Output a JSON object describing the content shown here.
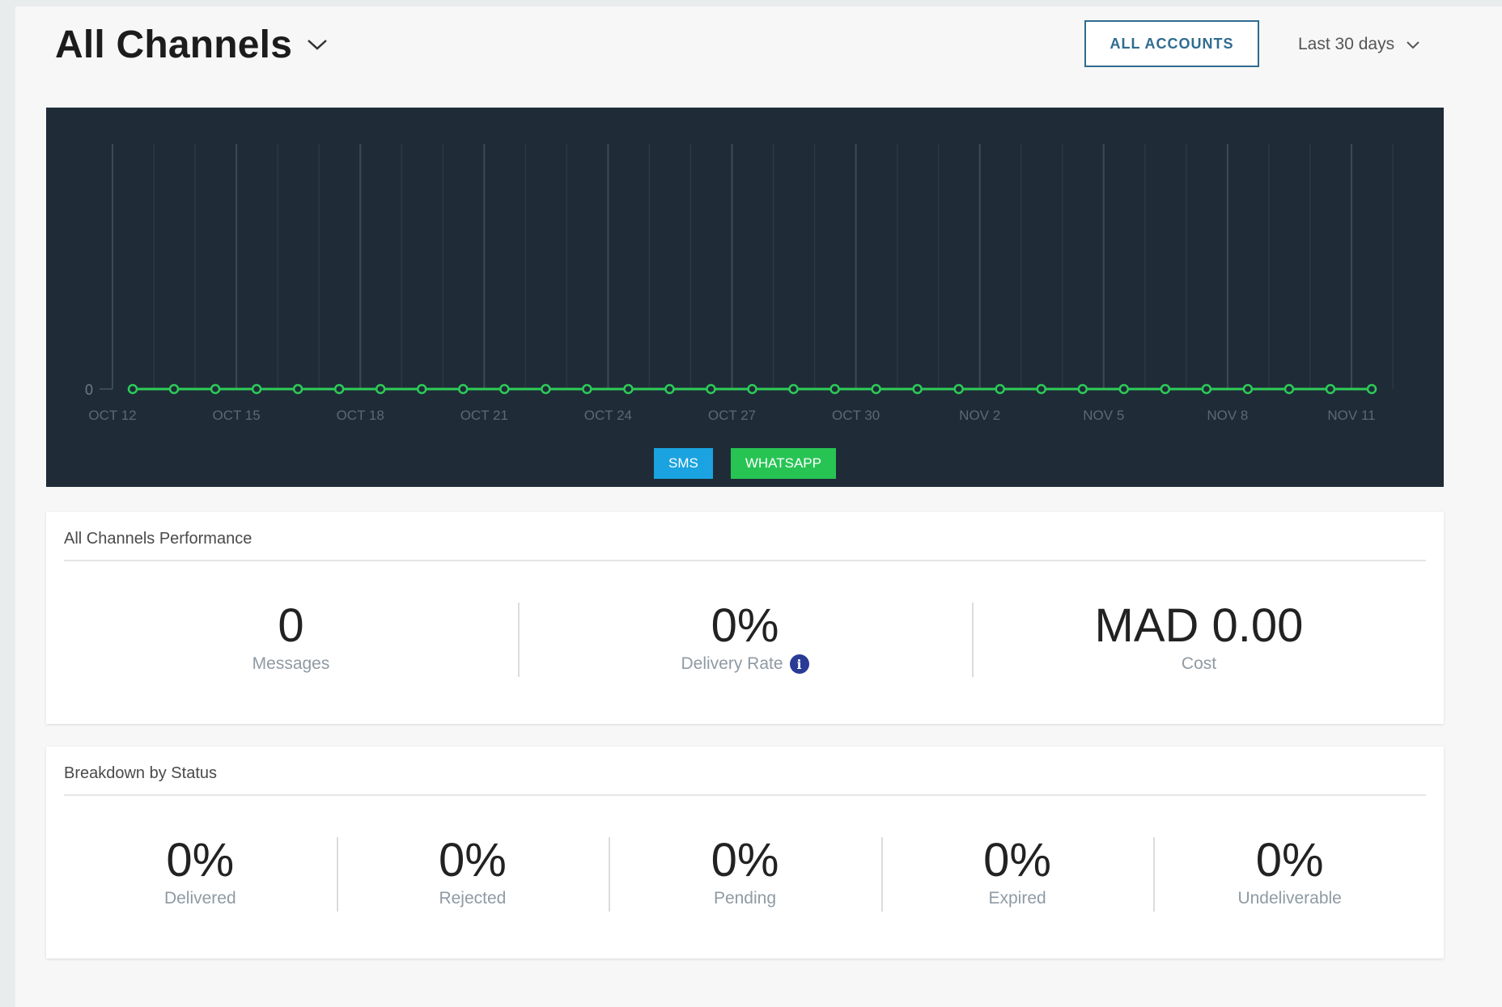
{
  "header": {
    "title": "All Channels",
    "accounts_button": "ALL ACCOUNTS",
    "date_range": "Last 30 days"
  },
  "legend": {
    "sms": "SMS",
    "whatsapp": "WHATSAPP"
  },
  "colors": {
    "chart_bg": "#1f2c38",
    "sms": "#1aa3e0",
    "whatsapp": "#27c454",
    "line": "#2dcc57",
    "accent": "#2f6c8f"
  },
  "chart_data": {
    "type": "line",
    "x": [
      "Oct 12",
      "Oct 13",
      "Oct 14",
      "Oct 15",
      "Oct 16",
      "Oct 17",
      "Oct 18",
      "Oct 19",
      "Oct 20",
      "Oct 21",
      "Oct 22",
      "Oct 23",
      "Oct 24",
      "Oct 25",
      "Oct 26",
      "Oct 27",
      "Oct 28",
      "Oct 29",
      "Oct 30",
      "Oct 31",
      "Nov 1",
      "Nov 2",
      "Nov 3",
      "Nov 4",
      "Nov 5",
      "Nov 6",
      "Nov 7",
      "Nov 8",
      "Nov 9",
      "Nov 10",
      "Nov 11"
    ],
    "tick_labels": [
      "OCT 12",
      "OCT 15",
      "OCT 18",
      "OCT 21",
      "OCT 24",
      "OCT 27",
      "OCT 30",
      "NOV 2",
      "NOV 5",
      "NOV 8",
      "NOV 11"
    ],
    "y_ticks": [
      "0"
    ],
    "series": [
      {
        "name": "WHATSAPP",
        "values": [
          0,
          0,
          0,
          0,
          0,
          0,
          0,
          0,
          0,
          0,
          0,
          0,
          0,
          0,
          0,
          0,
          0,
          0,
          0,
          0,
          0,
          0,
          0,
          0,
          0,
          0,
          0,
          0,
          0,
          0,
          0
        ]
      }
    ],
    "grid": true,
    "legend_position": "bottom-center"
  },
  "performance": {
    "title": "All Channels Performance",
    "stats": [
      {
        "value": "0",
        "label": "Messages"
      },
      {
        "value": "0%",
        "label": "Delivery Rate"
      },
      {
        "value": "MAD 0.00",
        "label": "Cost"
      }
    ]
  },
  "breakdown": {
    "title": "Breakdown by Status",
    "stats": [
      {
        "value": "0%",
        "label": "Delivered"
      },
      {
        "value": "0%",
        "label": "Rejected"
      },
      {
        "value": "0%",
        "label": "Pending"
      },
      {
        "value": "0%",
        "label": "Expired"
      },
      {
        "value": "0%",
        "label": "Undeliverable"
      }
    ]
  }
}
